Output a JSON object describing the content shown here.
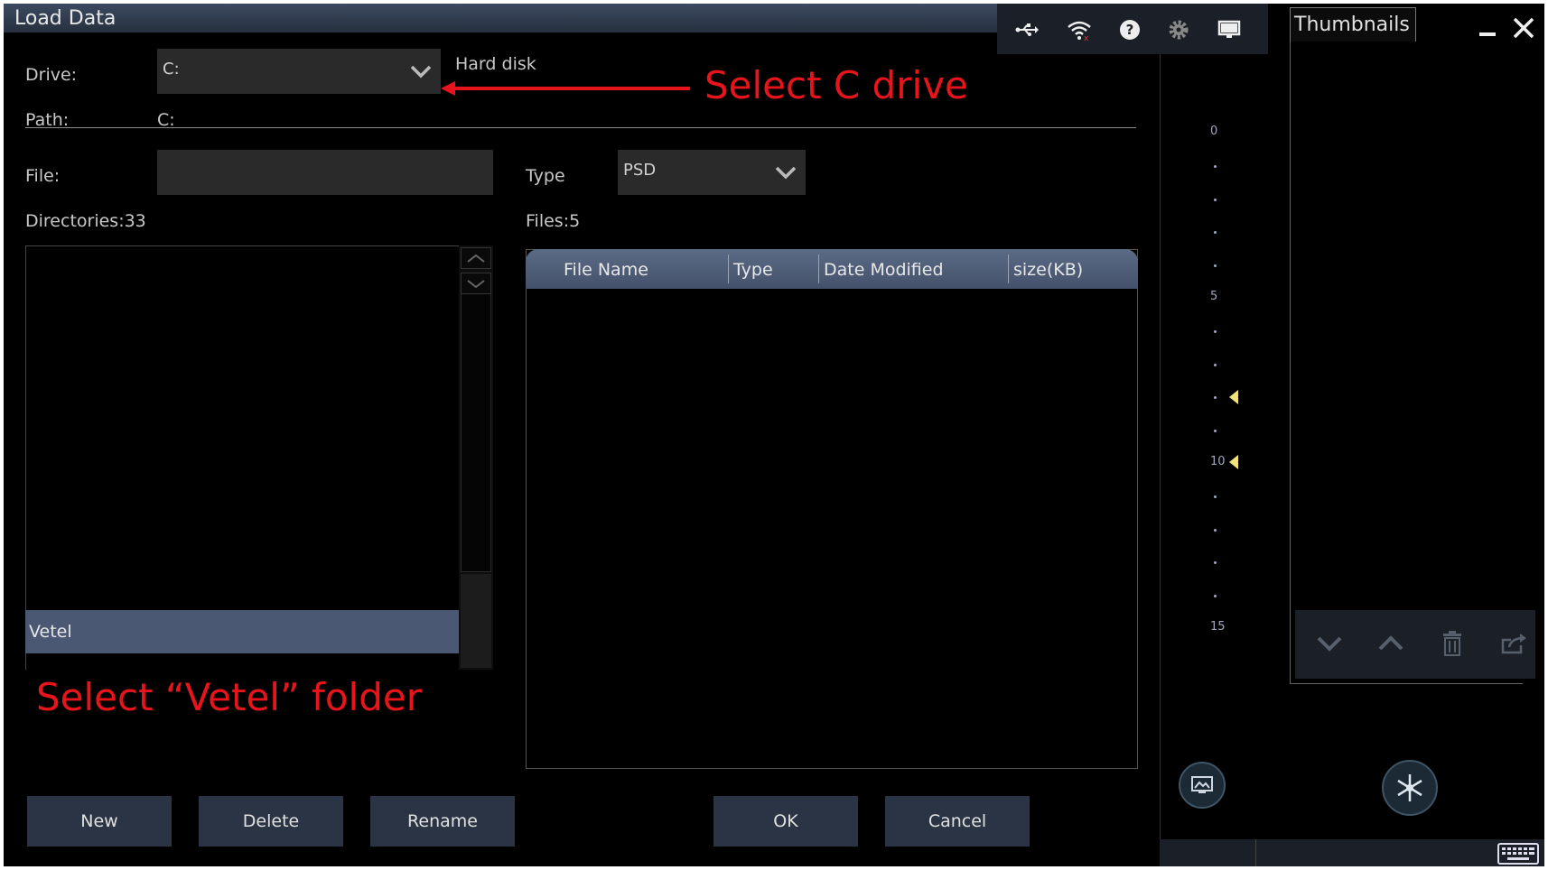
{
  "window": {
    "title": "Load Data"
  },
  "status_icons": [
    "usb-icon",
    "wifi-icon",
    "help-icon",
    "gear-icon",
    "monitor-icon"
  ],
  "drive": {
    "label": "Drive:",
    "value": "C:",
    "description": "Hard disk"
  },
  "path": {
    "label": "Path:",
    "value": "C:"
  },
  "file": {
    "label": "File:",
    "value": ""
  },
  "type": {
    "label": "Type",
    "value": "PSD"
  },
  "directories": {
    "label": "Directories:33",
    "selected": "Vetel"
  },
  "files": {
    "label": "Files:5",
    "columns": [
      "File Name",
      "Type",
      "Date Modified",
      "size(KB)"
    ]
  },
  "buttons": {
    "new": "New",
    "delete": "Delete",
    "rename": "Rename",
    "ok": "OK",
    "cancel": "Cancel"
  },
  "annotations": {
    "drive": "Select C drive",
    "folder": "Select “Vetel” folder"
  },
  "scale": {
    "ticks": [
      "0",
      "5",
      "10",
      "15"
    ]
  },
  "thumbnails": {
    "title": "Thumbnails"
  },
  "colors": {
    "annotation": "#e8141c",
    "selected_row": "#4a5873",
    "header": "#4e5c76"
  }
}
